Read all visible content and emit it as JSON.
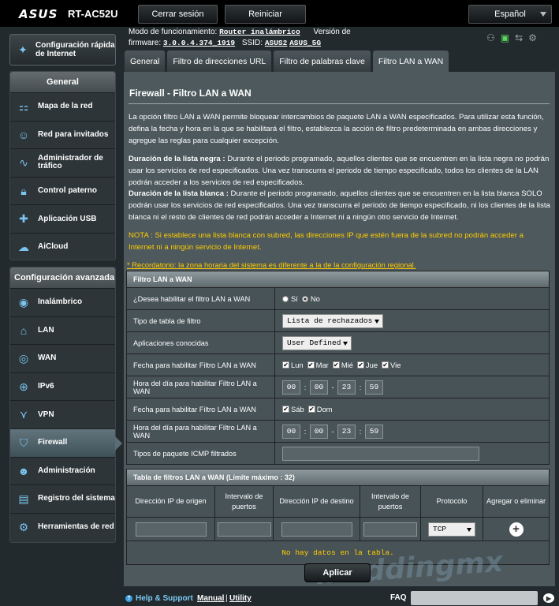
{
  "brand": {
    "logo": "ASUS",
    "model": "RT-AC52U"
  },
  "topbar": {
    "logout": "Cerrar sesión",
    "reboot": "Reiniciar",
    "language": "Español"
  },
  "info": {
    "mode_label": "Modo de funcionamiento:",
    "mode_value": "Router inalámbrico",
    "version_label": "Versión de",
    "firmware_label": "firmware:",
    "firmware_value": "3.0.0.4.374_1919",
    "ssid_label": "SSID:",
    "ssid_1": "ASUS2",
    "ssid_2": "ASUS_5G"
  },
  "sidebar": {
    "quick": "Configuración rápida de Internet",
    "general_title": "General",
    "general_items": [
      {
        "label": "Mapa de la red",
        "icon": "network-map-icon"
      },
      {
        "label": "Red para invitados",
        "icon": "guest-network-icon"
      },
      {
        "label": "Administrador de tráfico",
        "icon": "traffic-manager-icon"
      },
      {
        "label": "Control paterno",
        "icon": "parental-control-icon"
      },
      {
        "label": "Aplicación USB",
        "icon": "usb-app-icon"
      },
      {
        "label": "AiCloud",
        "icon": "aicloud-icon"
      }
    ],
    "advanced_title": "Configuración avanzada",
    "advanced_items": [
      {
        "label": "Inalámbrico",
        "icon": "wireless-icon"
      },
      {
        "label": "LAN",
        "icon": "lan-icon"
      },
      {
        "label": "WAN",
        "icon": "wan-icon"
      },
      {
        "label": "IPv6",
        "icon": "ipv6-icon"
      },
      {
        "label": "VPN",
        "icon": "vpn-icon"
      },
      {
        "label": "Firewall",
        "icon": "firewall-icon"
      },
      {
        "label": "Administración",
        "icon": "administration-icon"
      },
      {
        "label": "Registro del sistema",
        "icon": "system-log-icon"
      },
      {
        "label": "Herramientas de red",
        "icon": "network-tools-icon"
      }
    ],
    "active_item": "Firewall"
  },
  "tabs": [
    "General",
    "Filtro de direcciones URL",
    "Filtro de palabras clave",
    "Filtro LAN a WAN"
  ],
  "active_tab": "Filtro LAN a WAN",
  "page": {
    "title": "Firewall - Filtro LAN a WAN",
    "intro": "La opción filtro LAN a WAN permite bloquear intercambios de paquete LAN a WAN especificados. Para utilizar esta función, defina la fecha y hora en la que se habilitará el filtro, establezca la acción de filtro predeterminada en ambas direcciones y agregue las reglas para cualquier excepción.",
    "black_title": "Duración de la lista negra :",
    "black_text": " Durante el periodo programado, aquellos clientes que se encuentren en la lista negra no podrán usar los servicios de red especificados. Una vez transcurra el periodo de tiempo especificado, todos los clientes de la LAN podrán acceder a los servicios de red especificados.",
    "white_title": "Duración de la lista blanca :",
    "white_text": " Durante el periodo programado, aquellos clientes que se encuentren en la lista blanca SOLO podrán usar los servicios de red especificados. Una vez transcurra el periodo de tiempo especificado, ni los clientes de la lista blanca ni el resto de clientes de red podrán acceder a Internet ni a ningún otro servicio de Internet.",
    "note": "NOTA : Si establece una lista blanca con subred, las direcciones IP que estén fuera de la subred no podrán acceder a Internet ni a ningún servicio de Internet.",
    "reminder": "* Recordatorio: la zona horaria del sistema es diferente a la de la configuración regional."
  },
  "filter_table": {
    "title": "Filtro LAN a WAN",
    "enable_label": "¿Desea habilitar el filtro LAN a WAN",
    "yes": "Sí",
    "no": "No",
    "enabled": false,
    "type_label": "Tipo de tabla de filtro",
    "type_value": "Lista de rechazados",
    "apps_label": "Aplicaciones conocidas",
    "apps_value": "User Defined",
    "date1_label": "Fecha para habilitar Filtro LAN a WAN",
    "weekdays": [
      "Lun",
      "Mar",
      "Mié",
      "Jue",
      "Vie"
    ],
    "time1_label": "Hora del día para habilitar Filtro LAN a WAN",
    "time1": [
      "00",
      "00",
      "23",
      "59"
    ],
    "date2_label": "Fecha para habilitar Filtro LAN a WAN",
    "weekend": [
      "Sáb",
      "Dom"
    ],
    "time2_label": "Hora del día para habilitar Filtro LAN a WAN",
    "time2": [
      "00",
      "00",
      "23",
      "59"
    ],
    "icmp_label": "Tipos de paquete ICMP filtrados",
    "icmp_value": ""
  },
  "rules_table": {
    "title": "Tabla de filtros LAN a WAN (Límite máximo : 32)",
    "columns": [
      "Dirección IP de origen",
      "Intervalo de puertos",
      "Dirección IP de destino",
      "Intervalo de puertos",
      "Protocolo",
      "Agregar o eliminar"
    ],
    "protocol_value": "TCP",
    "empty": "No hay datos en la tabla."
  },
  "apply": "Aplicar",
  "footer": {
    "help": "Help & Support",
    "manual": "Manual",
    "sep": "|",
    "utility": "Utility",
    "faq": "FAQ"
  }
}
